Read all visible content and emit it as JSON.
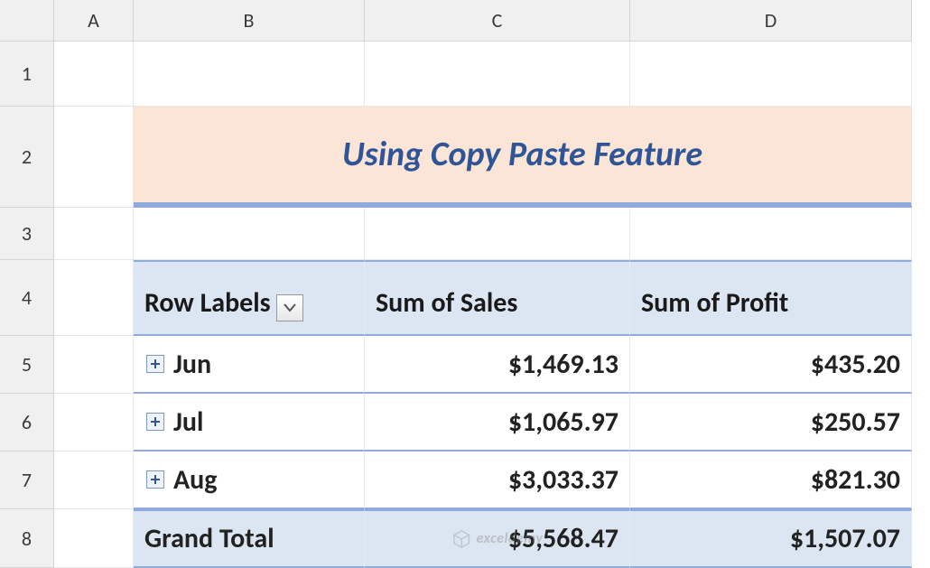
{
  "columns": [
    "A",
    "B",
    "C",
    "D"
  ],
  "rows": [
    "1",
    "2",
    "3",
    "4",
    "5",
    "6",
    "7",
    "8"
  ],
  "title": "Using Copy Paste Feature",
  "pivot": {
    "row_labels_header": "Row Labels",
    "col_headers": [
      "Sum of Sales",
      "Sum of Profit"
    ],
    "items": [
      {
        "label": "Jun",
        "sales": "$1,469.13",
        "profit": "$435.20"
      },
      {
        "label": "Jul",
        "sales": "$1,065.97",
        "profit": "$250.57"
      },
      {
        "label": "Aug",
        "sales": "$3,033.37",
        "profit": "$821.30"
      }
    ],
    "grand_total_label": "Grand Total",
    "grand_total": {
      "sales": "$5,568.47",
      "profit": "$1,507.07"
    }
  },
  "watermark": "exceldemy",
  "chart_data": {
    "type": "table",
    "title": "Using Copy Paste Feature",
    "categories": [
      "Jun",
      "Jul",
      "Aug",
      "Grand Total"
    ],
    "series": [
      {
        "name": "Sum of Sales",
        "values": [
          1469.13,
          1065.97,
          3033.37,
          5568.47
        ]
      },
      {
        "name": "Sum of Profit",
        "values": [
          435.2,
          250.57,
          821.3,
          1507.07
        ]
      }
    ]
  }
}
